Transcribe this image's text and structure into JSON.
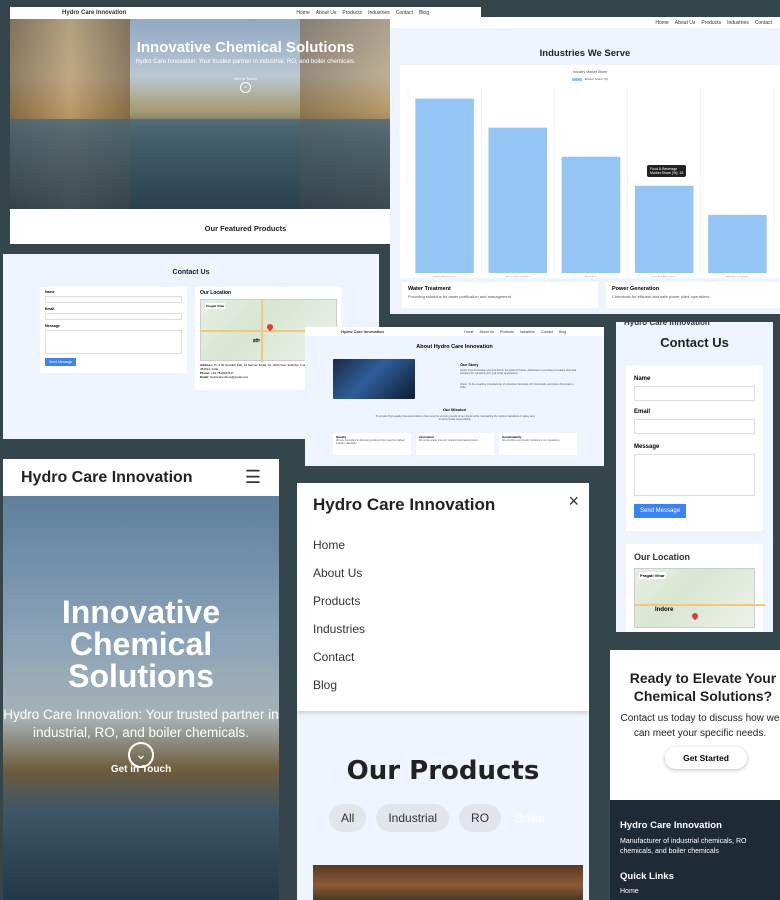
{
  "brand": "Hydro Care Innovation",
  "nav": [
    "Home",
    "About Us",
    "Products",
    "Industries",
    "Contact",
    "Blog"
  ],
  "hero": {
    "title": "Innovative Chemical Solutions",
    "subtitle": "Hydro Care Innovation: Your trusted partner in industrial, RO, and boiler chemicals.",
    "cta": "Get in Touch"
  },
  "featured": {
    "title": "Our Featured Products"
  },
  "industries": {
    "title": "Industries We Serve",
    "chart_data": {
      "type": "bar",
      "title": "Industry Market Share",
      "legend": "Market Share (%)",
      "categories": [
        "Water Treatment",
        "Power Generation",
        "Oil & Gas",
        "Food & Beverage",
        "Pharmaceuticals"
      ],
      "values": [
        30,
        25,
        20,
        15,
        10
      ],
      "ylim": [
        0,
        32
      ],
      "tooltip_title": "Food & Beverage",
      "tooltip_value": "Market Share (%): 15"
    },
    "cards": [
      {
        "title": "Water Treatment",
        "desc": "Providing solutions for water purification and management."
      },
      {
        "title": "Power Generation",
        "desc": "Chemicals for efficient and safe power plant operations."
      }
    ]
  },
  "contact": {
    "title": "Contact Us",
    "name_label": "Name",
    "email_label": "Email",
    "message_label": "Message",
    "send": "Send Message",
    "location_title": "Our Location",
    "map_place": "Pragati Vihar",
    "map_addr": "Pragati Vihar, Sukhi Nagar, Madhya Pradesh 452001",
    "map_link": "View larger map",
    "city": "Indore",
    "city_hi": "इंदौर",
    "address_label": "Address:",
    "address": "Pr. A 30 Sanskrit Patt, 31 Sanwer Road, 01, Vitth Kota, Sukhliya, Indore, Madhya Pradesh 452014, India",
    "phone_label": "Phone:",
    "phone": "+91 7816007617",
    "email_info_label": "Email:",
    "email_info": "hydrocareindore@gmail.com"
  },
  "about": {
    "title": "About Hydro Care Innovation",
    "story_title": "Our Story",
    "story": "Hydro Care Innovation was founded in the heart of Indore, dedicated to providing innovative chemical solutions for industrial, RO, and boiler applications.",
    "vision": "Vision: To be a leading manufacturer of industrial chemicals, RO chemicals, and boiler chemicals in India.",
    "mission_title": "Our Mission",
    "mission": "To provide high-quality chemical solutions that meet the evolving needs of our clients while maintaining the highest standards of safety and environmental responsibility.",
    "values": [
      {
        "t": "Quality",
        "d": "We are committed to delivering products that meet the highest industry standards."
      },
      {
        "t": "Innovation",
        "d": "We continuously invest in research and development."
      },
      {
        "t": "Sustainability",
        "d": "We prioritize eco-friendly solutions in our operations."
      }
    ]
  },
  "mobile": {
    "products_title": "Our Products",
    "filters": [
      "All",
      "Industrial",
      "RO",
      "Boiler"
    ]
  },
  "cta": {
    "title": "Ready to Elevate Your Chemical Solutions?",
    "text": "Contact us today to discuss how we can meet your specific needs.",
    "btn": "Get Started"
  },
  "footer": {
    "brand": "Hydro Care Innovation",
    "desc": "Manufacturer of industrial chemicals, RO chemicals, and boiler chemicals",
    "quick": "Quick Links",
    "home": "Home"
  }
}
